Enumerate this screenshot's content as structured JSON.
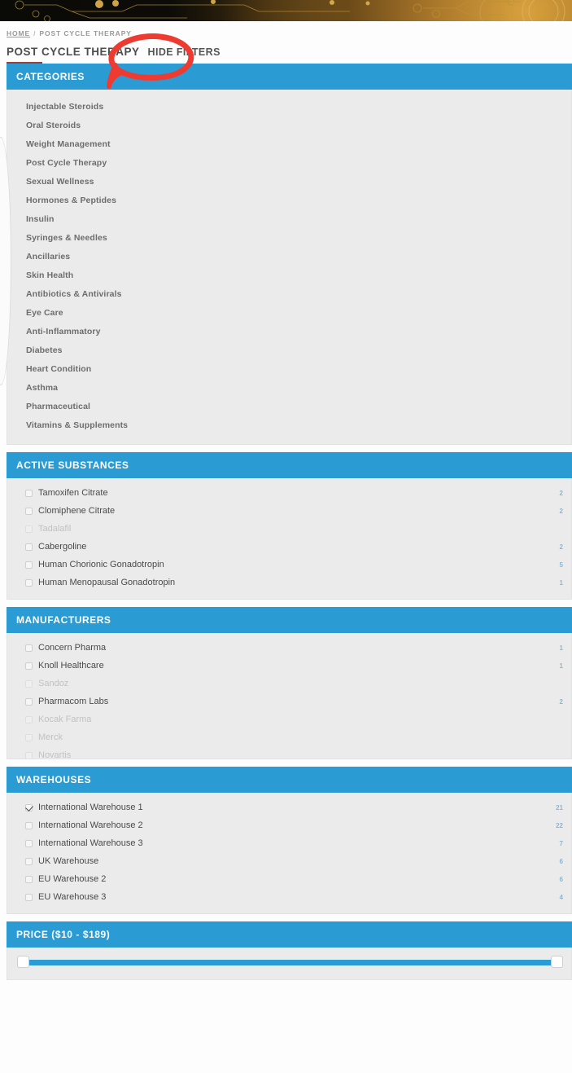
{
  "banner": {
    "name": "crypto-circuit-banner"
  },
  "breadcrumb": {
    "home_label": "HOME",
    "separator": "/",
    "current_label": "POST CYCLE THERAPY"
  },
  "header": {
    "title": "POST CYCLE THERAPY",
    "hide_filters_label": "HIDE FILTERS"
  },
  "colors": {
    "panel_header_blue": "#2b9bd4",
    "panel_body_grey": "#ebebeb",
    "count_blue": "#8fb6cf",
    "title_accent_red": "#a33b3b",
    "annotation_red": "#ee3b32"
  },
  "categories": {
    "title": "CATEGORIES",
    "items": [
      {
        "label": "Injectable Steroids"
      },
      {
        "label": "Oral Steroids"
      },
      {
        "label": "Weight Management"
      },
      {
        "label": "Post Cycle Therapy"
      },
      {
        "label": "Sexual Wellness"
      },
      {
        "label": "Hormones & Peptides"
      },
      {
        "label": "Insulin"
      },
      {
        "label": "Syringes & Needles"
      },
      {
        "label": "Ancillaries"
      },
      {
        "label": "Skin Health"
      },
      {
        "label": "Antibiotics & Antivirals"
      },
      {
        "label": "Eye Care"
      },
      {
        "label": "Anti-Inflammatory"
      },
      {
        "label": "Diabetes"
      },
      {
        "label": "Heart Condition"
      },
      {
        "label": "Asthma"
      },
      {
        "label": "Pharmaceutical"
      },
      {
        "label": "Vitamins & Supplements"
      }
    ]
  },
  "active_substances": {
    "title": "ACTIVE SUBSTANCES",
    "items": [
      {
        "label": "Tamoxifen Citrate",
        "count": "2",
        "checked": false,
        "disabled": false
      },
      {
        "label": "Clomiphene Citrate",
        "count": "2",
        "checked": false,
        "disabled": false
      },
      {
        "label": "Tadalafil",
        "count": "",
        "checked": false,
        "disabled": true
      },
      {
        "label": "Cabergoline",
        "count": "2",
        "checked": false,
        "disabled": false
      },
      {
        "label": "Human Chorionic Gonadotropin",
        "count": "5",
        "checked": false,
        "disabled": false
      },
      {
        "label": "Human Menopausal Gonadotropin",
        "count": "1",
        "checked": false,
        "disabled": false
      }
    ]
  },
  "manufacturers": {
    "title": "MANUFACTURERS",
    "items": [
      {
        "label": "Concern Pharma",
        "count": "1",
        "checked": false,
        "disabled": false
      },
      {
        "label": "Knoll Healthcare",
        "count": "1",
        "checked": false,
        "disabled": false
      },
      {
        "label": "Sandoz",
        "count": "",
        "checked": false,
        "disabled": true
      },
      {
        "label": "Pharmacom Labs",
        "count": "2",
        "checked": false,
        "disabled": false
      },
      {
        "label": "Kocak Farma",
        "count": "",
        "checked": false,
        "disabled": true
      },
      {
        "label": "Merck",
        "count": "",
        "checked": false,
        "disabled": true
      },
      {
        "label": "Novartis",
        "count": "",
        "checked": false,
        "disabled": true
      }
    ]
  },
  "warehouses": {
    "title": "WAREHOUSES",
    "items": [
      {
        "label": "International Warehouse 1",
        "count": "21",
        "checked": true,
        "disabled": false
      },
      {
        "label": "International Warehouse 2",
        "count": "22",
        "checked": false,
        "disabled": false
      },
      {
        "label": "International Warehouse 3",
        "count": "7",
        "checked": false,
        "disabled": false
      },
      {
        "label": "UK Warehouse",
        "count": "6",
        "checked": false,
        "disabled": false
      },
      {
        "label": "EU Warehouse 2",
        "count": "6",
        "checked": false,
        "disabled": false
      },
      {
        "label": "EU Warehouse 3",
        "count": "4",
        "checked": false,
        "disabled": false
      }
    ]
  },
  "price": {
    "title": "PRICE ($10 - $189)",
    "min_value": "$10",
    "max_value": "$189",
    "left_handle_pct": 0,
    "right_handle_pct": 100
  },
  "annotation": {
    "shape": "hand-drawn-ellipse-with-arrow",
    "targets": "HIDE FILTERS"
  }
}
